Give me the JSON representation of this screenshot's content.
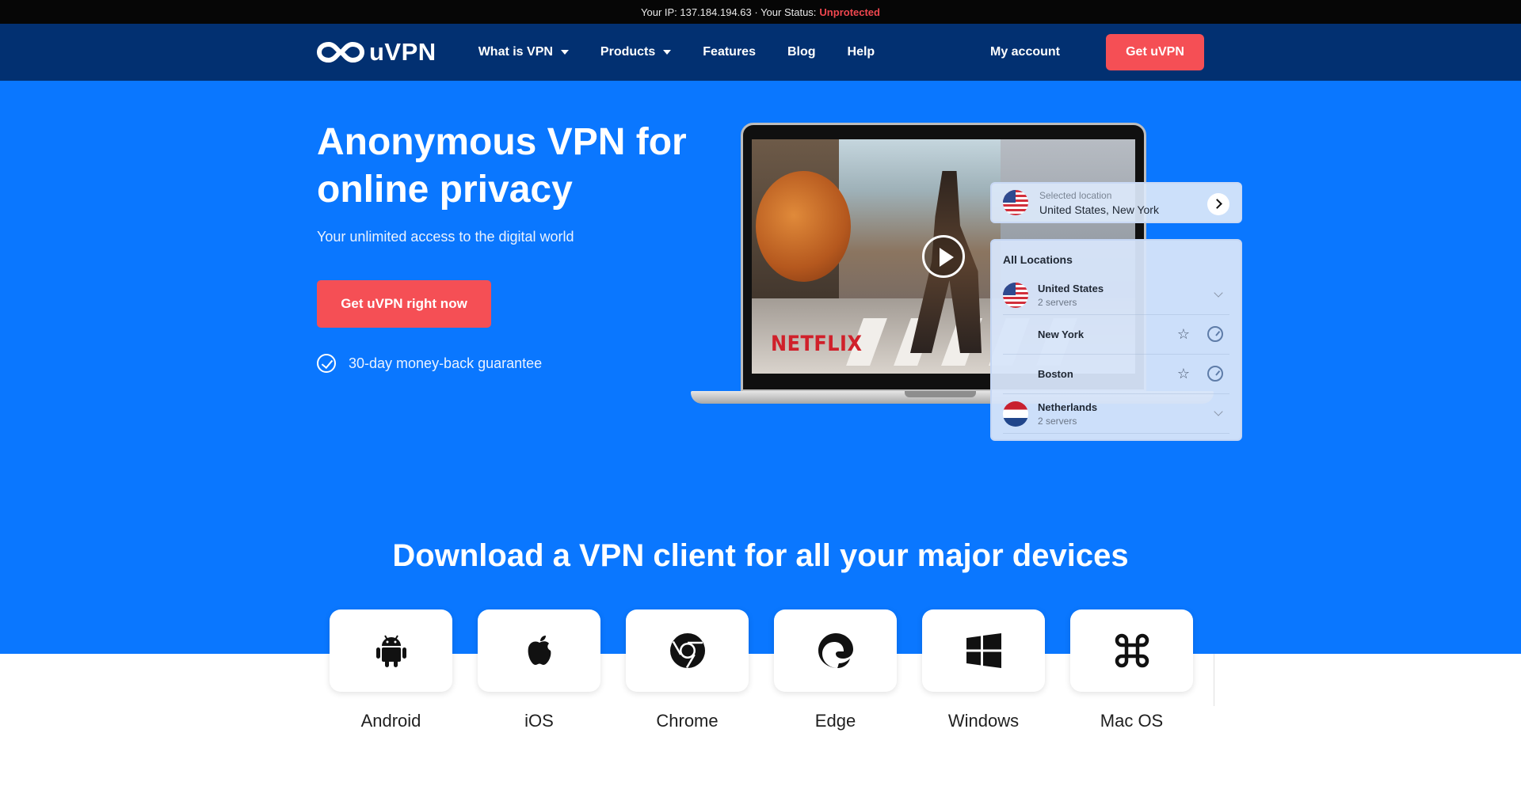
{
  "status_bar": {
    "ip_prefix": "Your IP: 137.184.194.63 · Your Status:",
    "status": "Unprotected"
  },
  "nav": {
    "logo_text": "uVPN",
    "menu": [
      {
        "label": "What is VPN",
        "dropdown": true
      },
      {
        "label": "Products",
        "dropdown": true
      },
      {
        "label": "Features",
        "dropdown": false
      },
      {
        "label": "Blog",
        "dropdown": false
      },
      {
        "label": "Help",
        "dropdown": false
      }
    ],
    "my_account": "My account",
    "cta": "Get uVPN"
  },
  "hero": {
    "title": "Anonymous VPN for online privacy",
    "subtitle": "Your unlimited access to the digital world",
    "cta": "Get uVPN right now",
    "guarantee": "30-day money-back guarantee"
  },
  "video": {
    "brand": "NETFLIX"
  },
  "selected_location": {
    "label": "Selected location",
    "value": "United States, New York"
  },
  "locations": {
    "heading": "All Locations",
    "countries": [
      {
        "name": "United States",
        "servers": "2 servers",
        "flag": "us",
        "cities": [
          "New York",
          "Boston"
        ]
      },
      {
        "name": "Netherlands",
        "servers": "2 servers",
        "flag": "nl",
        "cities": []
      }
    ]
  },
  "downloads": {
    "title": "Download a VPN client for all your major devices",
    "devices": [
      {
        "name": "Android",
        "icon": "android-icon"
      },
      {
        "name": "iOS",
        "icon": "apple-icon"
      },
      {
        "name": "Chrome",
        "icon": "chrome-icon"
      },
      {
        "name": "Edge",
        "icon": "edge-icon"
      },
      {
        "name": "Windows",
        "icon": "windows-icon"
      },
      {
        "name": "Mac OS",
        "icon": "command-icon"
      }
    ]
  },
  "colors": {
    "accent": "#f54f55",
    "hero_bg": "#0a77ff",
    "nav_bg": "#023071"
  }
}
